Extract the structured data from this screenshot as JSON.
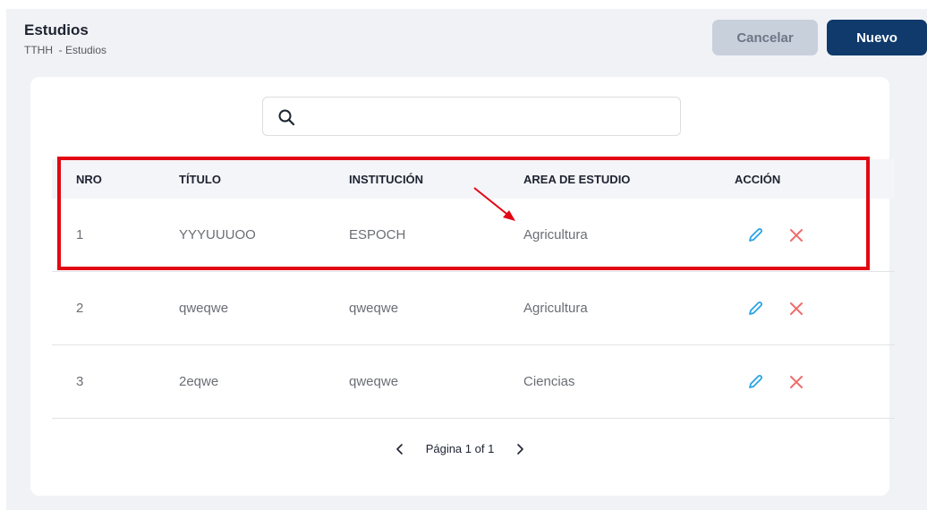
{
  "header": {
    "title": "Estudios",
    "breadcrumb": "TTHH  - Estudios",
    "cancel_label": "Cancelar",
    "new_label": "Nuevo"
  },
  "search": {
    "placeholder": "",
    "value": ""
  },
  "table": {
    "columns": [
      "NRO",
      "TÍTULO",
      "INSTITUCIÓN",
      "AREA DE ESTUDIO",
      "ACCIÓN"
    ],
    "rows": [
      {
        "nro": "1",
        "titulo": "YYYUUUOO",
        "institucion": "ESPOCH",
        "area": "Agricultura"
      },
      {
        "nro": "2",
        "titulo": "qweqwe",
        "institucion": "qweqwe",
        "area": "Agricultura"
      },
      {
        "nro": "3",
        "titulo": "2eqwe",
        "institucion": "qweqwe",
        "area": "Ciencias"
      }
    ]
  },
  "pagination": {
    "label": "Página 1 of 1"
  },
  "icons": {
    "edit": "pencil-icon",
    "delete": "close-icon",
    "search": "search-icon",
    "prev": "chevron-left-icon",
    "next": "chevron-right-icon"
  },
  "colors": {
    "primary": "#0f3a6b",
    "edit_icon": "#2aa3e6",
    "delete_icon": "#f06b6b",
    "annotation": "#e30613"
  }
}
